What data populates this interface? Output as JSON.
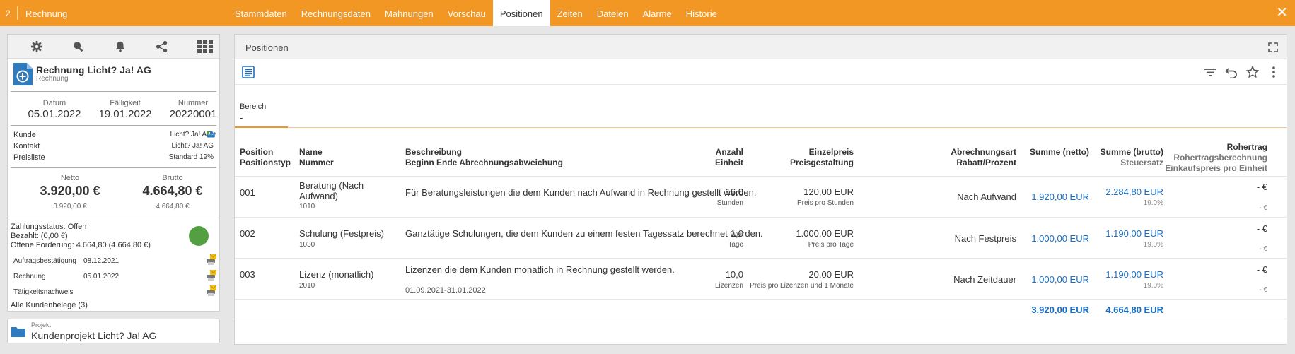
{
  "window": {
    "number": "2",
    "title": "Rechnung"
  },
  "tabs": [
    {
      "label": "Stammdaten"
    },
    {
      "label": "Rechnungsdaten"
    },
    {
      "label": "Mahnungen"
    },
    {
      "label": "Vorschau"
    },
    {
      "label": "Positionen",
      "active": true
    },
    {
      "label": "Zeiten"
    },
    {
      "label": "Dateien"
    },
    {
      "label": "Alarme"
    },
    {
      "label": "Historie"
    }
  ],
  "card": {
    "title": "Rechnung Licht? Ja! AG",
    "subtitle": "Rechnung",
    "meta": [
      {
        "label": "Datum",
        "value": "05.01.2022"
      },
      {
        "label": "Fälligkeit",
        "value": "19.01.2022"
      },
      {
        "label": "Nummer",
        "value": "20220001"
      }
    ],
    "kunde": {
      "label": "Kunde",
      "value": "Licht? Ja! AG"
    },
    "kontakt": {
      "label": "Kontakt",
      "value": "Licht? Ja! AG"
    },
    "preisliste": {
      "label": "Preisliste",
      "value": "Standard 19%"
    },
    "netto": {
      "label": "Netto",
      "value": "3.920,00 €",
      "sub": "3.920,00 €"
    },
    "brutto": {
      "label": "Brutto",
      "value": "4.664,80 €",
      "sub": "4.664,80 €"
    },
    "zahlungsstatus": "Zahlungsstatus: Offen",
    "bezahlt": "Bezahlt: (0,00 €)",
    "offen": "Offene Forderung: 4.664,80 (4.664,80 €)",
    "belege": [
      {
        "label": "Auftragsbestätigung",
        "date": "08.12.2021"
      },
      {
        "label": "Rechnung",
        "date": "05.01.2022"
      },
      {
        "label": "Tätigkeitsnachweis",
        "date": ""
      }
    ],
    "alle": "Alle Kundenbelege (3)"
  },
  "projekt": {
    "label": "Projekt",
    "value": "Kundenprojekt Licht? Ja! AG"
  },
  "main": {
    "title": "Positionen",
    "bereich_label": "Bereich",
    "bereich_value": "-"
  },
  "headers": {
    "position": "Position",
    "positionstyp": "Positionstyp",
    "name": "Name",
    "nummer": "Nummer",
    "beschreibung": "Beschreibung",
    "beginn_ende": "Beginn Ende Abrechnungsabweichung",
    "anzahl": "Anzahl",
    "einheit": "Einheit",
    "einzelpreis": "Einzelpreis",
    "preisgestaltung": "Preisgestaltung",
    "abrechnungsart": "Abrechnungsart",
    "rabatt": "Rabatt/Prozent",
    "summe_netto": "Summe (netto)",
    "summe_brutto": "Summe (brutto)",
    "steuersatz": "Steuersatz",
    "rohertrag": "Rohertrag",
    "rohertragsberechnung": "Rohertragsberechnung",
    "einkaufspreis": "Einkaufspreis pro Einheit"
  },
  "rows": [
    {
      "pos": "001",
      "name": "Beratung (Nach Aufwand)",
      "name1": "Beratung (Nach",
      "name2": "Aufwand)",
      "nummer": "1010",
      "beschreibung": "Für Beratungsleistungen die dem Kunden nach Aufwand in Rechnung gestellt werden.",
      "zeitraum": "",
      "anzahl": "16,0",
      "einheit": "Stunden",
      "preis": "120,00 EUR",
      "preis_sub": "Preis pro Stunden",
      "art": "Nach Aufwand",
      "netto": "1.920,00 EUR",
      "brutto": "2.284,80 EUR",
      "steuer": "19.0%",
      "rohertrag": "- €",
      "ek": "- €"
    },
    {
      "pos": "002",
      "name": "Schulung (Festpreis)",
      "name1": "Schulung (Festpreis)",
      "name2": "",
      "nummer": "1030",
      "beschreibung": "Ganztätige Schulungen, die dem Kunden zu einem festen Tagessatz berechnet werden.",
      "zeitraum": "",
      "anzahl": "1,0",
      "einheit": "Tage",
      "preis": "1.000,00 EUR",
      "preis_sub": "Preis pro Tage",
      "art": "Nach Festpreis",
      "netto": "1.000,00 EUR",
      "brutto": "1.190,00 EUR",
      "steuer": "19.0%",
      "rohertrag": "- €",
      "ek": "- €"
    },
    {
      "pos": "003",
      "name": "Lizenz (monatlich)",
      "name1": "Lizenz (monatlich)",
      "name2": "",
      "nummer": "2010",
      "beschreibung": "Lizenzen die dem Kunden monatlich in Rechnung gestellt werden.",
      "zeitraum": "01.09.2021-31.01.2022",
      "anzahl": "10,0",
      "einheit": "Lizenzen",
      "preis": "20,00 EUR",
      "preis_sub": "Preis pro Lizenzen und 1 Monate",
      "art": "Nach Zeitdauer",
      "netto": "1.000,00 EUR",
      "brutto": "1.190,00 EUR",
      "steuer": "19.0%",
      "rohertrag": "- €",
      "ek": "- €"
    }
  ],
  "totals": {
    "netto": "3.920,00 EUR",
    "brutto": "4.664,80 EUR"
  },
  "colors": {
    "accent": "#f29624",
    "link": "#1a6fc4",
    "status_ok": "#53a043",
    "doc_blue": "#2f7bbf"
  },
  "icons": [
    "gear-icon",
    "search-icon",
    "bell-icon",
    "share-icon",
    "grid-icon",
    "add-document-icon",
    "printer-mail-icon",
    "folder-icon",
    "expand-icon",
    "list-icon",
    "filter-icon",
    "undo-icon",
    "star-icon",
    "more-vertical-icon",
    "close-icon"
  ]
}
